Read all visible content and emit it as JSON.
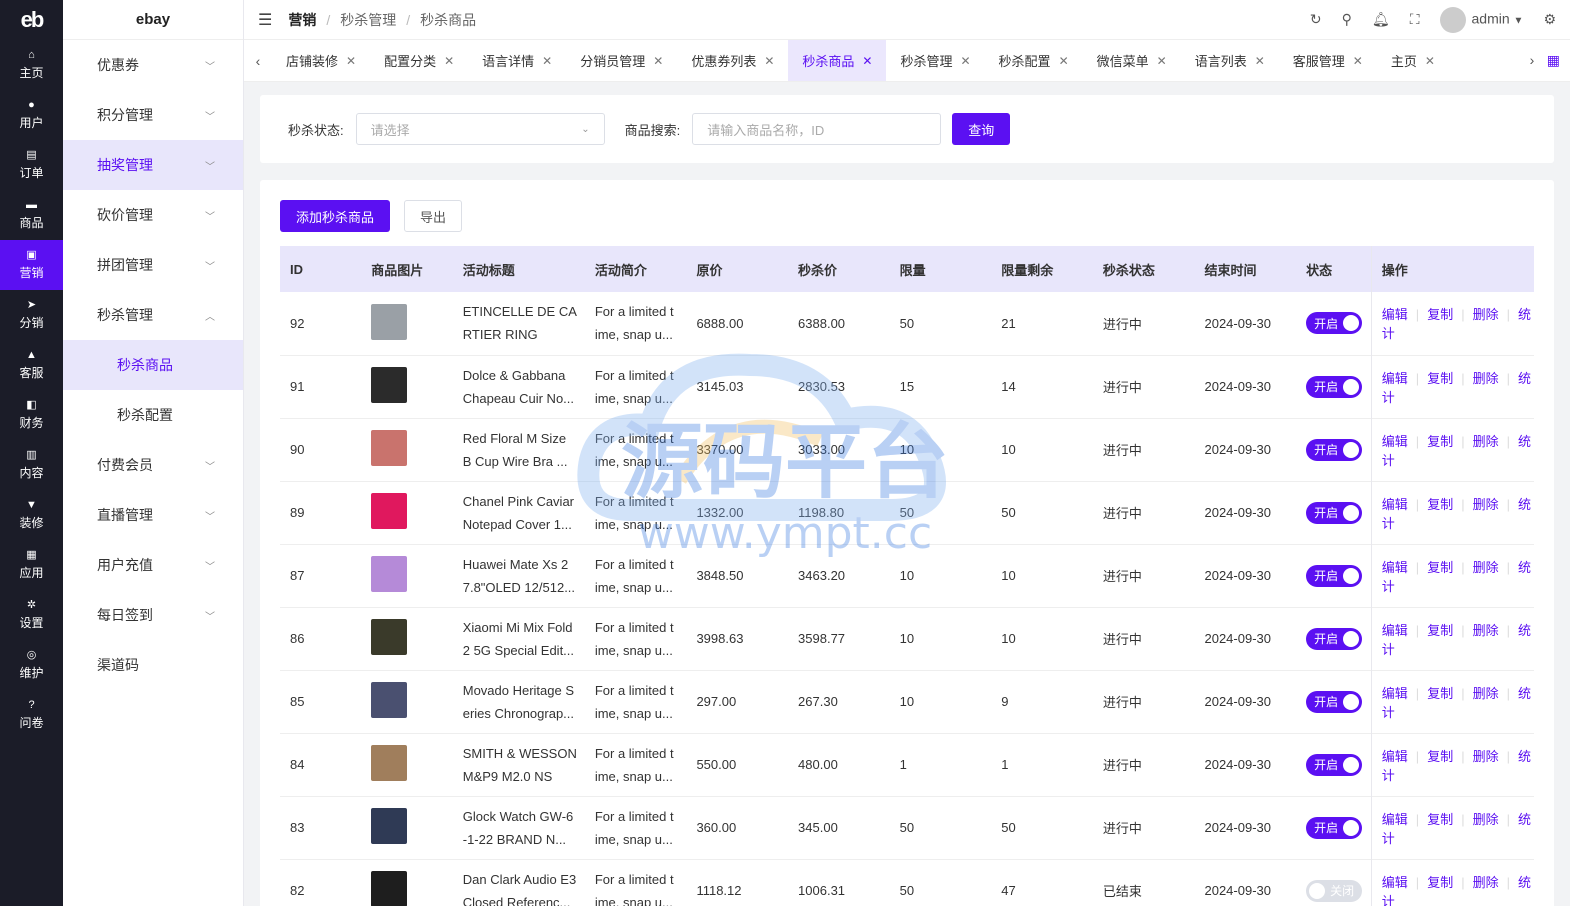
{
  "rail": {
    "logo": "eb",
    "items": [
      {
        "label": "主页",
        "icon": "home-icon"
      },
      {
        "label": "用户",
        "icon": "user-icon"
      },
      {
        "label": "订单",
        "icon": "order-icon"
      },
      {
        "label": "商品",
        "icon": "product-icon"
      },
      {
        "label": "营销",
        "icon": "marketing-icon"
      },
      {
        "label": "分销",
        "icon": "distribution-icon"
      },
      {
        "label": "客服",
        "icon": "service-icon"
      },
      {
        "label": "财务",
        "icon": "finance-icon"
      },
      {
        "label": "内容",
        "icon": "content-icon"
      },
      {
        "label": "装修",
        "icon": "decorate-icon"
      },
      {
        "label": "应用",
        "icon": "apps-icon"
      },
      {
        "label": "设置",
        "icon": "settings-icon"
      },
      {
        "label": "维护",
        "icon": "maintain-icon"
      },
      {
        "label": "问卷",
        "icon": "question-icon"
      }
    ]
  },
  "submenu": {
    "brand": "ebay",
    "items": [
      "优惠券",
      "积分管理",
      "抽奖管理",
      "砍价管理",
      "拼团管理",
      "秒杀管理"
    ],
    "children": [
      "秒杀商品",
      "秒杀配置"
    ],
    "items2": [
      "付费会员",
      "直播管理",
      "用户充值",
      "每日签到",
      "渠道码"
    ]
  },
  "topbar": {
    "crumb1": "营销",
    "crumb2": "秒杀管理",
    "crumb3": "秒杀商品",
    "user": "admin"
  },
  "tabs": [
    "店铺装修",
    "配置分类",
    "语言详情",
    "分销员管理",
    "优惠券列表",
    "秒杀商品",
    "秒杀管理",
    "秒杀配置",
    "微信菜单",
    "语言列表",
    "客服管理",
    "主页"
  ],
  "filter": {
    "status_label": "秒杀状态:",
    "status_placeholder": "请选择",
    "search_label": "商品搜索:",
    "search_placeholder": "请输入商品名称，ID",
    "query_btn": "查询"
  },
  "actions": {
    "add": "添加秒杀商品",
    "export": "导出"
  },
  "table": {
    "headers": [
      "ID",
      "商品图片",
      "活动标题",
      "活动简介",
      "原价",
      "秒杀价",
      "限量",
      "限量剩余",
      "秒杀状态",
      "结束时间",
      "状态",
      "操作"
    ],
    "rows": [
      {
        "id": "92",
        "t1": "ETINCELLE DE CA",
        "t2": "RTIER RING",
        "d1": "For a limited t",
        "d2": "ime, snap u...",
        "price": "6888.00",
        "sale": "6388.00",
        "limit": "50",
        "left": "21",
        "state": "进行中",
        "end": "2024-09-30",
        "on": true,
        "color": "#9aa0a6"
      },
      {
        "id": "91",
        "t1": "Dolce & Gabbana",
        "t2": "Chapeau Cuir No...",
        "d1": "For a limited t",
        "d2": "ime, snap u...",
        "price": "3145.03",
        "sale": "2830.53",
        "limit": "15",
        "left": "14",
        "state": "进行中",
        "end": "2024-09-30",
        "on": true,
        "color": "#2b2b2b"
      },
      {
        "id": "90",
        "t1": "Red Floral M Size",
        "t2": "B Cup Wire Bra ...",
        "d1": "For a limited t",
        "d2": "ime, snap u...",
        "price": "3370.00",
        "sale": "3033.00",
        "limit": "10",
        "left": "10",
        "state": "进行中",
        "end": "2024-09-30",
        "on": true,
        "color": "#c9736d"
      },
      {
        "id": "89",
        "t1": "Chanel Pink Caviar",
        "t2": "Notepad Cover 1...",
        "d1": "For a limited t",
        "d2": "ime, snap u...",
        "price": "1332.00",
        "sale": "1198.80",
        "limit": "50",
        "left": "50",
        "state": "进行中",
        "end": "2024-09-30",
        "on": true,
        "color": "#e0185e"
      },
      {
        "id": "87",
        "t1": "Huawei Mate Xs 2",
        "t2": "7.8\"OLED 12/512...",
        "d1": "For a limited t",
        "d2": "ime, snap u...",
        "price": "3848.50",
        "sale": "3463.20",
        "limit": "10",
        "left": "10",
        "state": "进行中",
        "end": "2024-09-30",
        "on": true,
        "color": "#b58ad8"
      },
      {
        "id": "86",
        "t1": "Xiaomi Mi Mix Fold",
        "t2": "2 5G Special Edit...",
        "d1": "For a limited t",
        "d2": "ime, snap u...",
        "price": "3998.63",
        "sale": "3598.77",
        "limit": "10",
        "left": "10",
        "state": "进行中",
        "end": "2024-09-30",
        "on": true,
        "color": "#3a3a2a"
      },
      {
        "id": "85",
        "t1": "Movado Heritage S",
        "t2": "eries Chronograp...",
        "d1": "For a limited t",
        "d2": "ime, snap u...",
        "price": "297.00",
        "sale": "267.30",
        "limit": "10",
        "left": "9",
        "state": "进行中",
        "end": "2024-09-30",
        "on": true,
        "color": "#4a5070"
      },
      {
        "id": "84",
        "t1": "SMITH & WESSON",
        "t2": "M&P9 M2.0 NS",
        "d1": "For a limited t",
        "d2": "ime, snap u...",
        "price": "550.00",
        "sale": "480.00",
        "limit": "1",
        "left": "1",
        "state": "进行中",
        "end": "2024-09-30",
        "on": true,
        "color": "#a07e5c"
      },
      {
        "id": "83",
        "t1": "Glock Watch GW-6",
        "t2": "-1-22 BRAND N...",
        "d1": "For a limited t",
        "d2": "ime, snap u...",
        "price": "360.00",
        "sale": "345.00",
        "limit": "50",
        "left": "50",
        "state": "进行中",
        "end": "2024-09-30",
        "on": true,
        "color": "#2f3a55"
      },
      {
        "id": "82",
        "t1": "Dan Clark Audio E3",
        "t2": "Closed Referenc...",
        "d1": "For a limited t",
        "d2": "ime, snap u...",
        "price": "1118.12",
        "sale": "1006.31",
        "limit": "50",
        "left": "47",
        "state": "已结束",
        "end": "2024-09-30",
        "on": false,
        "color": "#1e1e1e"
      }
    ],
    "on_label": "开启",
    "off_label": "关闭",
    "ops": [
      "编辑",
      "复制",
      "删除",
      "统计"
    ]
  },
  "watermark": {
    "line1": "源码平台",
    "line2": "www.ympt.cc"
  }
}
